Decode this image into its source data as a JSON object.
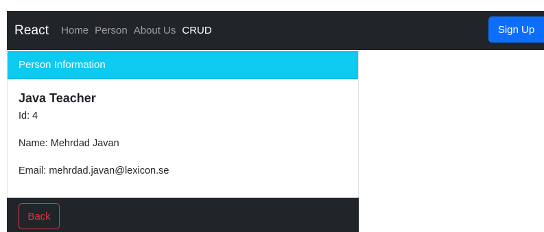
{
  "navbar": {
    "brand": "React",
    "links": [
      {
        "label": "Home",
        "active": false
      },
      {
        "label": "Person",
        "active": false
      },
      {
        "label": "About Us",
        "active": false
      },
      {
        "label": "CRUD",
        "active": true
      }
    ],
    "signup_label": "Sign Up"
  },
  "card": {
    "header": "Person Information",
    "title": "Java Teacher",
    "id_text": "Id: 4",
    "name_text": "Name: Mehrdad Javan",
    "email_text": "Email: mehrdad.javan@lexicon.se"
  },
  "footer": {
    "back_label": "Back"
  },
  "colors": {
    "navbar_bg": "#212529",
    "primary": "#0d6efd",
    "info": "#0dcaf0",
    "danger": "#dc3545"
  }
}
